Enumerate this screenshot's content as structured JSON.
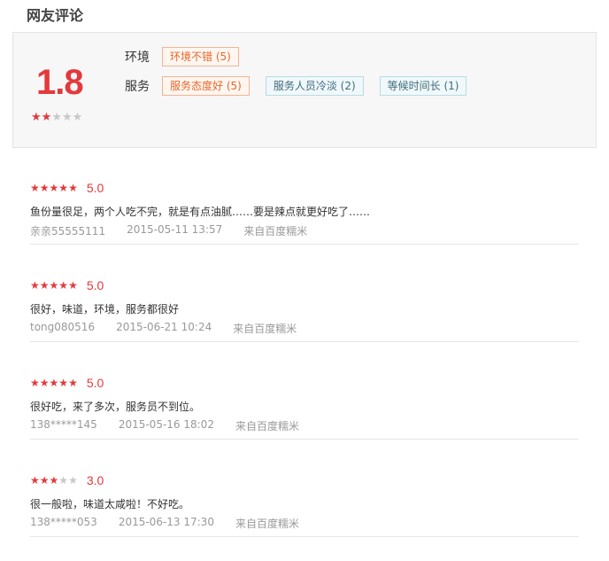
{
  "header": {
    "title": "网友评论"
  },
  "summary": {
    "score": "1.8",
    "stars_on": 2,
    "stars_total": 5,
    "groups": [
      {
        "label": "环境",
        "tags": [
          {
            "text": "环境不错 (5)",
            "type": "positive"
          }
        ]
      },
      {
        "label": "服务",
        "tags": [
          {
            "text": "服务态度好 (5)",
            "type": "positive"
          },
          {
            "text": "服务人员冷淡 (2)",
            "type": "negative"
          },
          {
            "text": "等候时间长 (1)",
            "type": "negative"
          }
        ]
      }
    ]
  },
  "reviews": [
    {
      "stars_on": 5,
      "rating": "5.0",
      "content": "鱼份量很足，两个人吃不完，就是有点油腻……要是辣点就更好吃了……",
      "user": "亲亲55555111",
      "time": "2015-05-11 13:57",
      "source": "来自百度糯米"
    },
    {
      "stars_on": 5,
      "rating": "5.0",
      "content": "很好，味道，环境，服务都很好",
      "user": "tong080516",
      "time": "2015-06-21 10:24",
      "source": "来自百度糯米"
    },
    {
      "stars_on": 5,
      "rating": "5.0",
      "content": "很好吃，来了多次，服务员不到位。",
      "user": "138*****145",
      "time": "2015-05-16 18:02",
      "source": "来自百度糯米"
    },
    {
      "stars_on": 3,
      "rating": "3.0",
      "content": "很一般啦，味道太咸啦！不好吃。",
      "user": "138*****053",
      "time": "2015-06-13 17:30",
      "source": "来自百度糯米"
    }
  ],
  "colors": {
    "accent": "#e4393c",
    "positive_tag": "#e8682a",
    "negative_tag": "#3f6c7a"
  }
}
